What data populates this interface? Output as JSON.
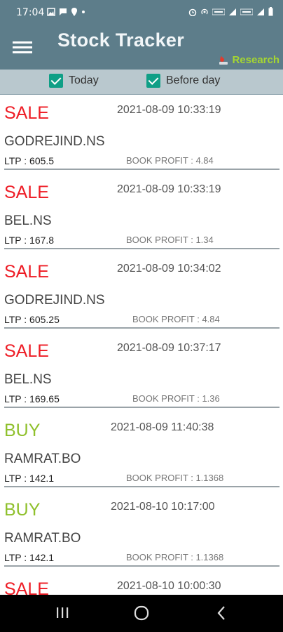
{
  "status_bar": {
    "time": "17:04"
  },
  "app_bar": {
    "title": "Stock Tracker",
    "research_label": "Research"
  },
  "filters": [
    {
      "label": "Today",
      "checked": true
    },
    {
      "label": "Before day",
      "checked": true
    }
  ],
  "trades": [
    {
      "action": "SALE",
      "timestamp": "2021-08-09 10:33:19",
      "symbol": "GODREJIND.NS",
      "ltp": "LTP : 605.5",
      "profit": "BOOK PROFIT : 4.84"
    },
    {
      "action": "SALE",
      "timestamp": "2021-08-09 10:33:19",
      "symbol": "BEL.NS",
      "ltp": "LTP : 167.8",
      "profit": "BOOK PROFIT : 1.34"
    },
    {
      "action": "SALE",
      "timestamp": "2021-08-09 10:34:02",
      "symbol": "GODREJIND.NS",
      "ltp": "LTP : 605.25",
      "profit": "BOOK PROFIT : 4.84"
    },
    {
      "action": "SALE",
      "timestamp": "2021-08-09 10:37:17",
      "symbol": "BEL.NS",
      "ltp": "LTP : 169.65",
      "profit": "BOOK PROFIT : 1.36"
    },
    {
      "action": "BUY",
      "timestamp": "2021-08-09 11:40:38",
      "symbol": "RAMRAT.BO",
      "ltp": "LTP : 142.1",
      "profit": "BOOK PROFIT : 1.1368"
    },
    {
      "action": "BUY",
      "timestamp": "2021-08-10 10:17:00",
      "symbol": "RAMRAT.BO",
      "ltp": "LTP : 142.1",
      "profit": "BOOK PROFIT : 1.1368"
    },
    {
      "action": "SALE",
      "timestamp": "2021-08-10 10:00:30",
      "symbol": "",
      "ltp": "",
      "profit": ""
    }
  ],
  "colors": {
    "app_bar": "#5d7d8a",
    "filter_bar": "#b9c8ce",
    "sale": "#ee1c25",
    "buy": "#8fc02c",
    "research": "#a5d631",
    "checkbox": "#0f9f86"
  },
  "icons": {
    "menu": "hamburger-icon",
    "research": "research-icon",
    "nav_recents": "recents-icon",
    "nav_home": "home-icon",
    "nav_back": "back-icon"
  }
}
